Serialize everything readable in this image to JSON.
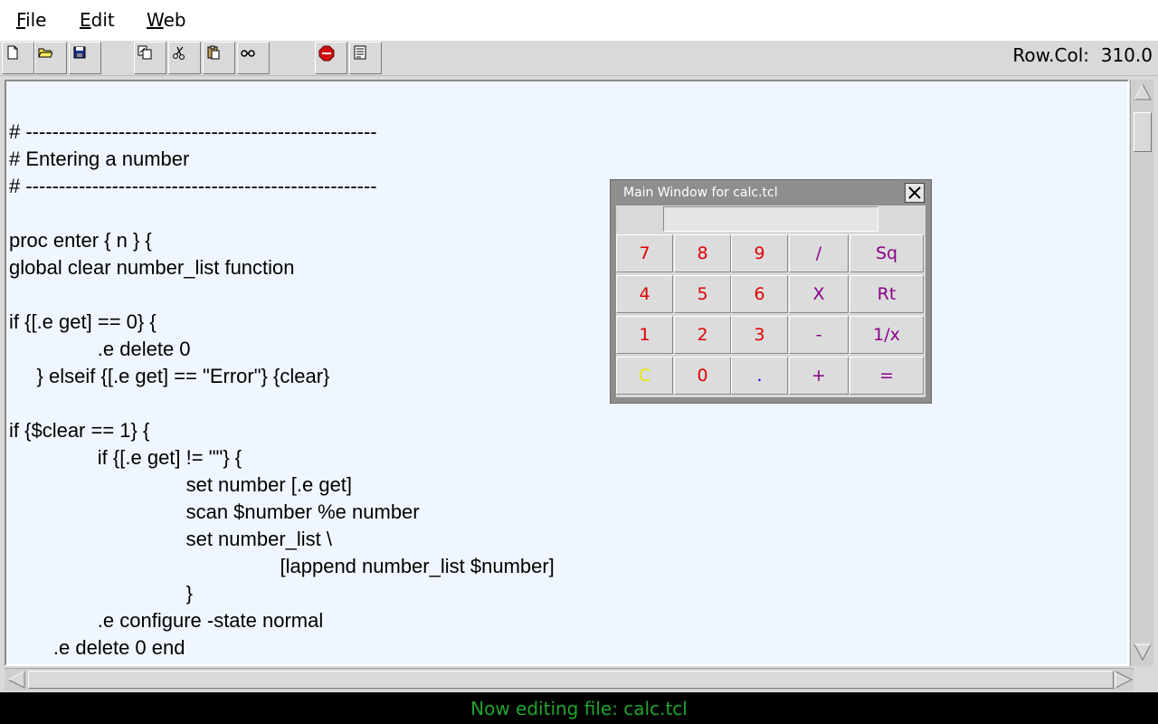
{
  "menu": {
    "file": {
      "mnemonic": "F",
      "rest": "ile"
    },
    "edit": {
      "mnemonic": "E",
      "rest": "dit"
    },
    "web": {
      "mnemonic": "W",
      "rest": "eb"
    }
  },
  "toolbar": {
    "buttons": [
      {
        "icon": "new-file-icon"
      },
      {
        "icon": "open-folder-icon"
      },
      {
        "icon": "save-disk-icon"
      },
      {
        "icon": "copy-icon"
      },
      {
        "icon": "cut-scissors-icon"
      },
      {
        "icon": "paste-icon"
      },
      {
        "icon": "find-binoculars-icon"
      },
      {
        "icon": "stop-icon"
      },
      {
        "icon": "document-icon"
      }
    ],
    "row_col_label": "Row.Col:",
    "row_col_value": "310.0"
  },
  "editor": {
    "lines": [
      "# -----------------------------------------------------",
      "# Entering a number",
      "# -----------------------------------------------------",
      "",
      "proc enter { n } {",
      "global clear number_list function",
      "",
      "if {[.e get] == 0} {",
      "                .e delete 0",
      "     } elseif {[.e get] == \"Error\"} {clear}",
      "",
      "if {$clear == 1} {",
      "                if {[.e get] != \"\"} {",
      "                                set number [.e get]",
      "                                scan $number %e number",
      "                                set number_list \\",
      "                                                 [lappend number_list $number]",
      "                                }",
      "                .e configure -state normal",
      "        .e delete 0 end"
    ]
  },
  "status": {
    "text": "Now editing file: calc.tcl",
    "color": "#1fa52a"
  },
  "calculator": {
    "title": "Main Window for calc.tcl",
    "display_value": "",
    "colors": {
      "digit": "#e00000",
      "operator": "#8a008a",
      "clear": "#e8e800",
      "dot": "#0000cc"
    },
    "keys": [
      {
        "label": "7",
        "kind": "digit"
      },
      {
        "label": "8",
        "kind": "digit"
      },
      {
        "label": "9",
        "kind": "digit"
      },
      {
        "label": "/",
        "kind": "operator"
      },
      {
        "label": "Sq",
        "kind": "operator"
      },
      {
        "label": "4",
        "kind": "digit"
      },
      {
        "label": "5",
        "kind": "digit"
      },
      {
        "label": "6",
        "kind": "digit"
      },
      {
        "label": "X",
        "kind": "operator"
      },
      {
        "label": "Rt",
        "kind": "operator"
      },
      {
        "label": "1",
        "kind": "digit"
      },
      {
        "label": "2",
        "kind": "digit"
      },
      {
        "label": "3",
        "kind": "digit"
      },
      {
        "label": "-",
        "kind": "operator"
      },
      {
        "label": "1/x",
        "kind": "operator"
      },
      {
        "label": "C",
        "kind": "clear"
      },
      {
        "label": "0",
        "kind": "digit"
      },
      {
        "label": ".",
        "kind": "dot"
      },
      {
        "label": "+",
        "kind": "operator"
      },
      {
        "label": "=",
        "kind": "operator"
      }
    ]
  }
}
